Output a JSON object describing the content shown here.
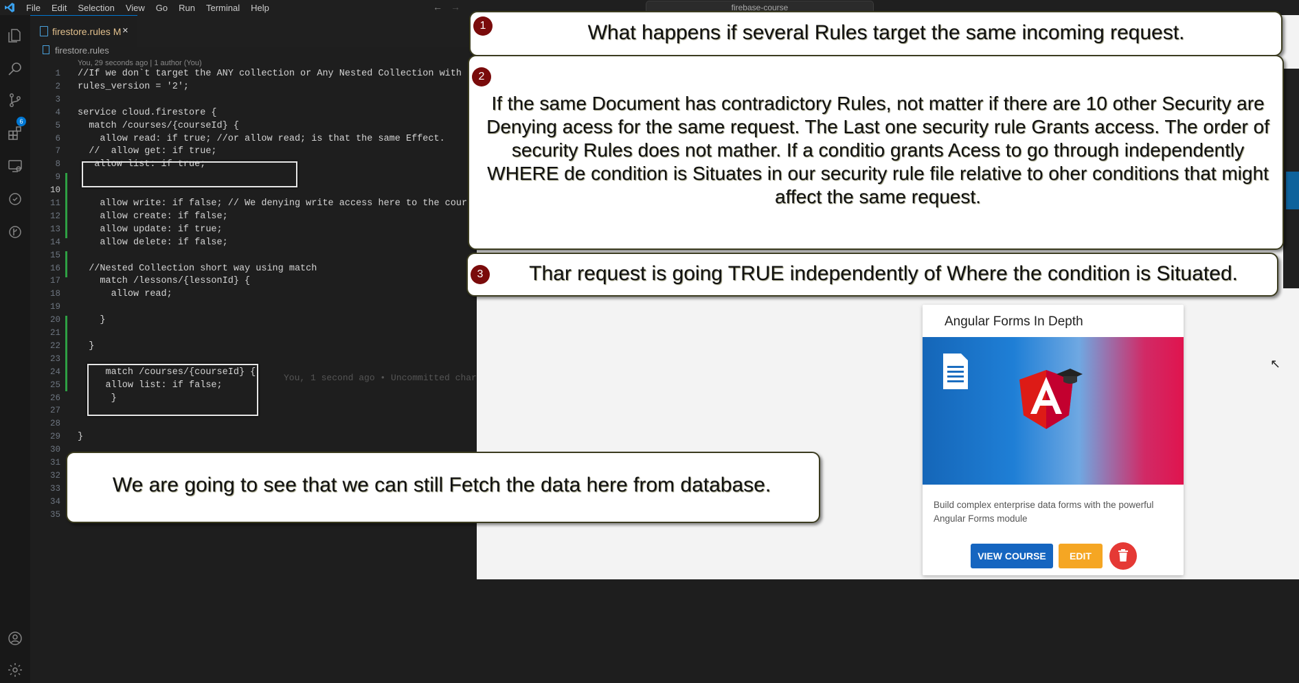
{
  "menu": [
    "File",
    "Edit",
    "Selection",
    "View",
    "Go",
    "Run",
    "Terminal",
    "Help"
  ],
  "search": {
    "text": "firebase-course"
  },
  "activity": {
    "scm_badge": "6"
  },
  "tab": {
    "name": "firestore.rules",
    "modified": "M",
    "close": "×"
  },
  "breadcrumb": {
    "file": "firestore.rules"
  },
  "blame_header": "You, 29 seconds ago | 1 author (You)",
  "code_lines": [
    {
      "n": "1",
      "t": "//If we don`t target the ANY collection or Any Nested Collection with a ru"
    },
    {
      "n": "2",
      "t": "rules_version = '2';"
    },
    {
      "n": "3",
      "t": ""
    },
    {
      "n": "4",
      "t": "service cloud.firestore {"
    },
    {
      "n": "5",
      "t": "  match /courses/{courseId} {"
    },
    {
      "n": "6",
      "t": "    allow read: if true; //or allow read; is that the same Effect."
    },
    {
      "n": "7",
      "t": "  //  allow get: if true;"
    },
    {
      "n": "8",
      "t": "   allow list: if true;"
    },
    {
      "n": "9",
      "t": ""
    },
    {
      "n": "10",
      "t": ""
    },
    {
      "n": "11",
      "t": "    allow write: if false; // We denying write access here to the course."
    },
    {
      "n": "12",
      "t": "    allow create: if false;"
    },
    {
      "n": "13",
      "t": "    allow update: if true;"
    },
    {
      "n": "14",
      "t": "    allow delete: if false;"
    },
    {
      "n": "15",
      "t": ""
    },
    {
      "n": "16",
      "t": "  //Nested Collection short way using match"
    },
    {
      "n": "17",
      "t": "    match /lessons/{lessonId} {"
    },
    {
      "n": "18",
      "t": "      allow read;"
    },
    {
      "n": "19",
      "t": ""
    },
    {
      "n": "20",
      "t": "    }"
    },
    {
      "n": "21",
      "t": ""
    },
    {
      "n": "22",
      "t": "  }"
    },
    {
      "n": "23",
      "t": ""
    },
    {
      "n": "24",
      "t": "     match /courses/{courseId} {"
    },
    {
      "n": "25",
      "t": "     allow list: if false;"
    },
    {
      "n": "26",
      "t": "      }"
    },
    {
      "n": "27",
      "t": ""
    },
    {
      "n": "28",
      "t": ""
    },
    {
      "n": "29",
      "t": "}"
    },
    {
      "n": "30",
      "t": ""
    },
    {
      "n": "31",
      "t": ""
    },
    {
      "n": "32",
      "t": ""
    },
    {
      "n": "33",
      "t": ""
    },
    {
      "n": "34",
      "t": ""
    },
    {
      "n": "35",
      "t": ""
    }
  ],
  "current_line": "10",
  "inline_blame": "You, 1 second ago • Uncommitted char",
  "callouts": [
    {
      "num": "1",
      "text": "What happens if several Rules target the same incoming request."
    },
    {
      "num": "2",
      "text": "If the same Document has contradictory Rules, not matter if there are 10 other Security are Denying acess for the same request. The Last one security rule Grants access. The order of security Rules does not mather.  If a conditio grants Acess to go through independently WHERE de condition is Situates in our security rule file relative to oher conditions that might affect the same request."
    },
    {
      "num": "3",
      "text": "Thar request is going TRUE independently of Where the condition is Situated."
    },
    {
      "num": "",
      "text": "We are going to see  that we can still Fetch the data here  from database."
    }
  ],
  "card": {
    "title": "Angular Forms In Depth",
    "description": "Build complex enterprise data forms with the powerful Angular Forms module",
    "view_label": "VIEW COURSE",
    "edit_label": "EDIT"
  },
  "colors": {
    "accent": "#0078d4",
    "view_button": "#1565c0",
    "edit_button": "#f5a623",
    "delete_button": "#e53935",
    "callout_number": "#7a0b0b"
  },
  "icons": [
    "vscode-logo-icon",
    "explorer-icon",
    "search-icon",
    "source-control-icon",
    "extensions-icon",
    "remote-explorer-icon",
    "testing-icon",
    "git-graph-icon",
    "account-icon",
    "settings-gear-icon",
    "document-icon",
    "angular-logo-icon",
    "trash-icon"
  ]
}
